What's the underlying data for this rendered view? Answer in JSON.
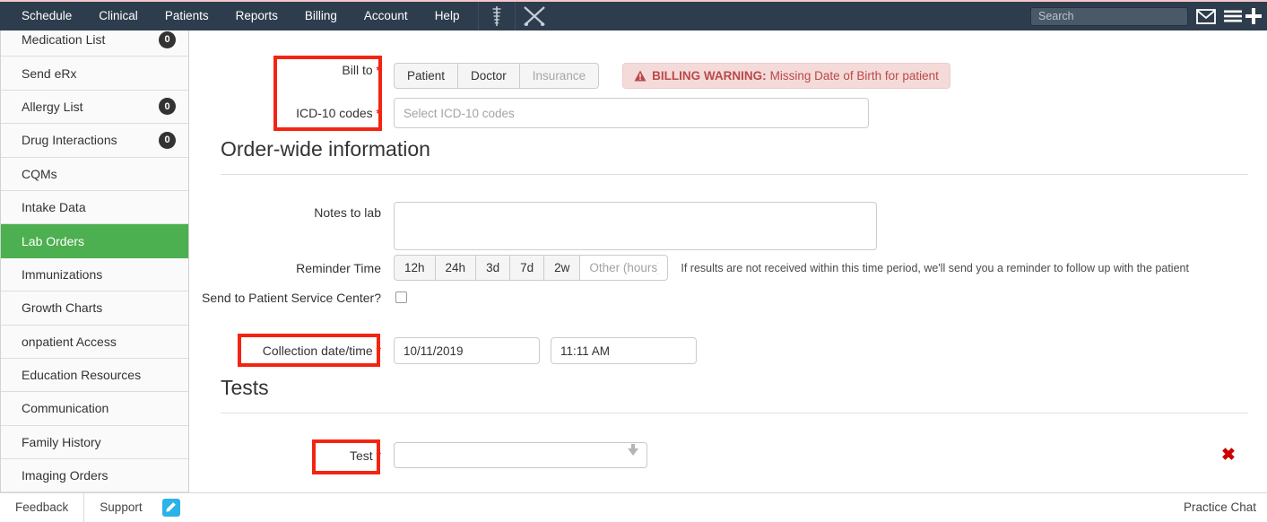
{
  "topnav": {
    "items": [
      {
        "label": "Schedule"
      },
      {
        "label": "Clinical"
      },
      {
        "label": "Patients"
      },
      {
        "label": "Reports"
      },
      {
        "label": "Billing"
      },
      {
        "label": "Account"
      },
      {
        "label": "Help"
      }
    ],
    "icons": [
      {
        "name": "caduceus-icon"
      },
      {
        "name": "crossed-scalpels-icon"
      }
    ],
    "search": {
      "value": "",
      "placeholder": "Search"
    },
    "right_icons": [
      {
        "name": "envelope-icon"
      },
      {
        "name": "hamburger-menu-icon"
      },
      {
        "name": "plus-icon"
      }
    ],
    "bg_color": "#2e3d4d"
  },
  "sidebar": {
    "active_color": "#4caf50",
    "items": [
      {
        "label": "Medication List",
        "badge": "0",
        "active": false
      },
      {
        "label": "Send eRx",
        "badge": "",
        "active": false
      },
      {
        "label": "Allergy List",
        "badge": "0",
        "active": false
      },
      {
        "label": "Drug Interactions",
        "badge": "0",
        "active": false
      },
      {
        "label": "CQMs",
        "badge": "",
        "active": false
      },
      {
        "label": "Intake Data",
        "badge": "",
        "active": false
      },
      {
        "label": "Lab Orders",
        "badge": "",
        "active": true
      },
      {
        "label": "Immunizations",
        "badge": "",
        "active": false
      },
      {
        "label": "Growth Charts",
        "badge": "",
        "active": false
      },
      {
        "label": "onpatient Access",
        "badge": "",
        "active": false
      },
      {
        "label": "Education Resources",
        "badge": "",
        "active": false
      },
      {
        "label": "Communication",
        "badge": "",
        "active": false
      },
      {
        "label": "Family History",
        "badge": "",
        "active": false
      },
      {
        "label": "Imaging Orders",
        "badge": "",
        "active": false
      }
    ]
  },
  "form": {
    "bill_to": {
      "label": "Bill to",
      "required_marker": "*",
      "options": [
        {
          "label": "Patient",
          "disabled": false
        },
        {
          "label": "Doctor",
          "disabled": false
        },
        {
          "label": "Insurance",
          "disabled": true
        }
      ]
    },
    "billing_warning": {
      "prefix": "BILLING WARNING:",
      "message": "Missing Date of Birth for patient",
      "color": "#b94a48"
    },
    "icd10": {
      "label": "ICD-10 codes",
      "required_marker": "*",
      "value": "",
      "placeholder": "Select ICD-10 codes"
    },
    "order_wide": {
      "title": "Order-wide information",
      "notes_to_lab": {
        "label": "Notes to lab",
        "value": "",
        "placeholder": ""
      },
      "reminder_time": {
        "label": "Reminder Time",
        "options": [
          "12h",
          "24h",
          "3d",
          "7d",
          "2w"
        ],
        "other": {
          "value": "",
          "placeholder": "Other (hours)"
        },
        "hint": "If results are not received within this time period, we'll send you a reminder to follow up with the patient"
      },
      "patient_service_center": {
        "label": "Send to Patient Service Center?",
        "checked": false
      },
      "collection": {
        "label": "Collection date/time",
        "required_marker": "*",
        "date_value": "10/11/2019",
        "time_value": "11:11 AM"
      }
    },
    "tests": {
      "title": "Tests",
      "rows": [
        {
          "label": "Test",
          "required_marker": "*",
          "value": "",
          "delete_label": "✖"
        }
      ]
    }
  },
  "footer": {
    "feedback": "Feedback",
    "support": "Support",
    "edit_icon": "pencil-icon",
    "practice_chat": "Practice Chat"
  }
}
